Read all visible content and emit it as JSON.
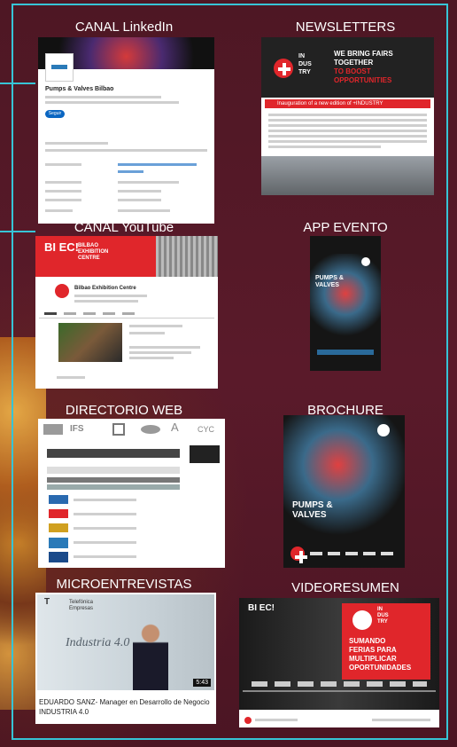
{
  "labels": {
    "linkedin": "CANAL LinkedIn",
    "newsletters": "NEWSLETTERS",
    "youtube": "CANAL YouTube",
    "app": "APP EVENTO",
    "directorio": "DIRECTORIO WEB",
    "brochure": "BROCHURE",
    "micro": "MICROENTREVISTAS",
    "video": "VIDEORESUMEN"
  },
  "linkedin_card": {
    "company": "Pumps & Valves Bilbao",
    "follow": "Seguir"
  },
  "newsletter_card": {
    "in": "IN",
    "dus": "DUS",
    "try": "TRY",
    "headline1": "WE BRING FAIRS",
    "headline2": "TOGETHER",
    "headline3": "TO BOOST",
    "headline4": "OPPORTUNITIES",
    "banner": "Inauguration of a new edition of +INDUSTRY"
  },
  "youtube_card": {
    "brand": "BI EC!",
    "sub": "BILBAO EXHIBITION CENTRE",
    "channel": "Bilbao Exhibition Centre"
  },
  "app_card": {
    "title": "PUMPS & VALVES"
  },
  "brochure_card": {
    "title": "PUMPS & VALVES"
  },
  "directorio_card": {
    "l1": "IFS",
    "l2": "CYC"
  },
  "micro_card": {
    "logo": "Telefónica Empresas",
    "slide": "Industria 4.0",
    "time": "5:43",
    "caption": "EDUARDO SANZ- Manager en Desarrollo de Negocio INDUSTRIA 4.0"
  },
  "video_card": {
    "brand": "BI EC!",
    "in": "IN",
    "dus": "DUS",
    "try": "TRY",
    "l1": "SUMANDO",
    "l2": "FERIAS PARA",
    "l3": "MULTIPLICAR",
    "l4": "OPORTUNIDADES"
  },
  "colors": {
    "frame": "#37c4d6",
    "background": "#4a1622",
    "accent_red": "#e0262b"
  }
}
